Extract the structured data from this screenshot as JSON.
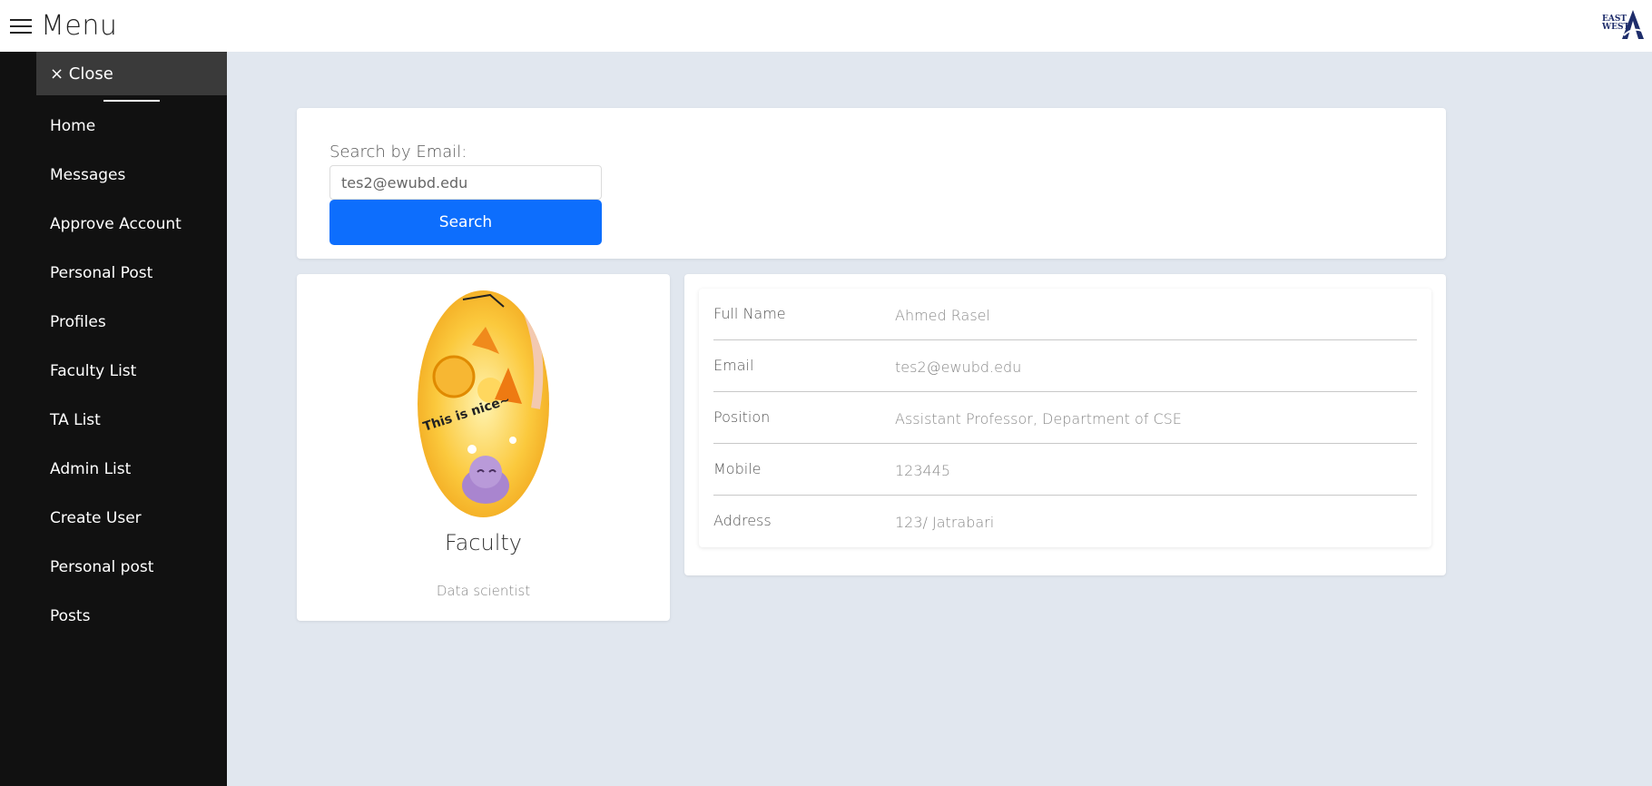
{
  "header": {
    "menu_label": "Menu",
    "logo_text": "EAST WEST"
  },
  "sidebar": {
    "close_label": "× Close",
    "items": [
      {
        "label": "Home"
      },
      {
        "label": "Messages"
      },
      {
        "label": "Approve Account"
      },
      {
        "label": "Personal Post"
      },
      {
        "label": "Profiles"
      },
      {
        "label": "Faculty List"
      },
      {
        "label": "TA List"
      },
      {
        "label": "Admin List"
      },
      {
        "label": "Create User"
      },
      {
        "label": "Personal post"
      },
      {
        "label": "Posts"
      }
    ]
  },
  "search": {
    "label": "Search by Email:",
    "value": "tes2@ewubd.edu",
    "button_label": "Search"
  },
  "profile": {
    "role": "Faculty",
    "subtitle": "Data scientist",
    "avatar_caption": "This is nice~"
  },
  "details": {
    "rows": [
      {
        "label": "Full Name",
        "value": "Ahmed Rasel"
      },
      {
        "label": "Email",
        "value": "tes2@ewubd.edu"
      },
      {
        "label": "Position",
        "value": "Assistant Professor, Department of CSE"
      },
      {
        "label": "Mobile",
        "value": "123445"
      },
      {
        "label": "Address",
        "value": "123/ Jatrabari"
      }
    ]
  },
  "colors": {
    "background": "#e1e7ef",
    "sidebar": "#111111",
    "close_bar": "#3a3a3a",
    "primary_button": "#0d6efd",
    "logo": "#1e2d6b"
  }
}
